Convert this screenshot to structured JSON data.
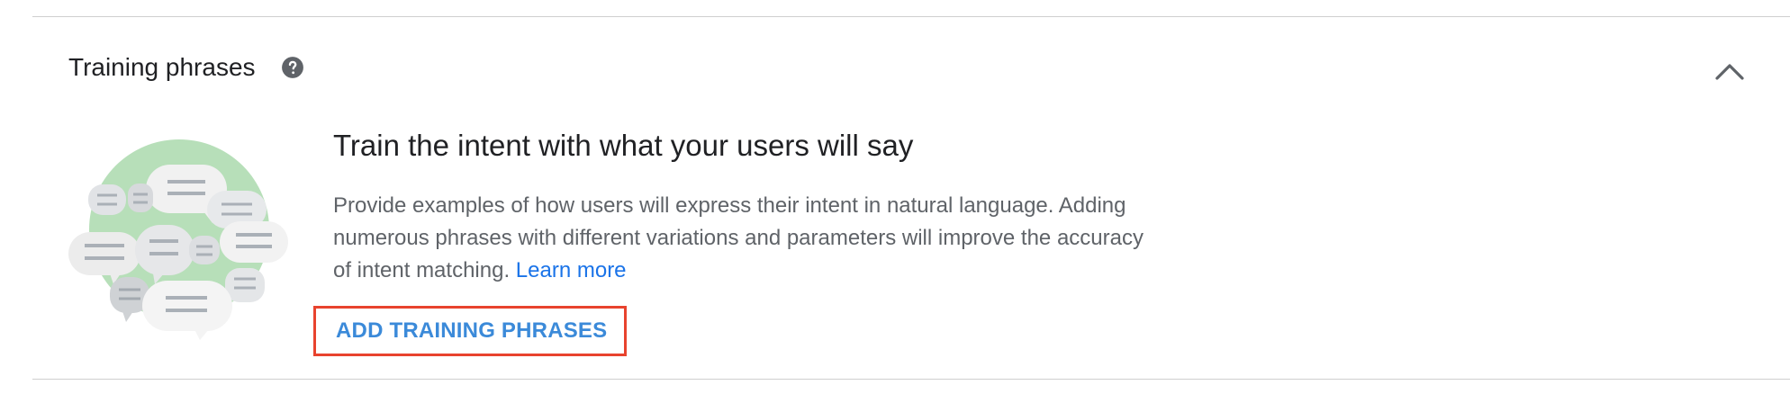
{
  "section": {
    "title": "Training phrases",
    "help_icon": "help-circle-icon",
    "collapse_icon": "chevron-up-icon"
  },
  "empty_state": {
    "headline": "Train the intent with what your users will say",
    "description": "Provide examples of how users will express their intent in natural language. Adding numerous phrases with different variations and parameters will improve the accuracy of intent matching.",
    "learn_more_label": "Learn more",
    "illustration": "chat-bubbles-illustration",
    "add_button_label": "ADD TRAINING PHRASES"
  },
  "colors": {
    "accent": "#1a73e8",
    "button_text": "#3b8ad9",
    "highlight_border": "#e8432e",
    "illustration_circle": "#b7dfb9"
  }
}
